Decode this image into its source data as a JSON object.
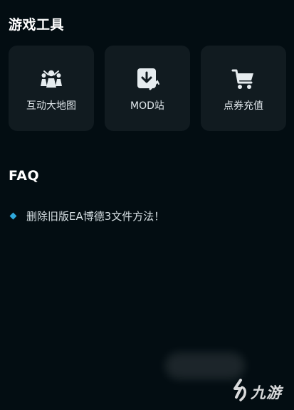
{
  "sections": {
    "tools_title": "游戏工具",
    "faq_title": "FAQ"
  },
  "tools": [
    {
      "label": "互动大地图",
      "icon": "people-map-icon"
    },
    {
      "label": "MOD站",
      "icon": "download-arrow-icon"
    },
    {
      "label": "点券充值",
      "icon": "shopping-cart-icon"
    }
  ],
  "faq": [
    {
      "text": "删除旧版EA博德3文件方法！"
    }
  ],
  "watermark": {
    "text": "九游"
  },
  "colors": {
    "background": "#030d12",
    "card": "#111b20",
    "bullet": "#2fa9dd"
  }
}
